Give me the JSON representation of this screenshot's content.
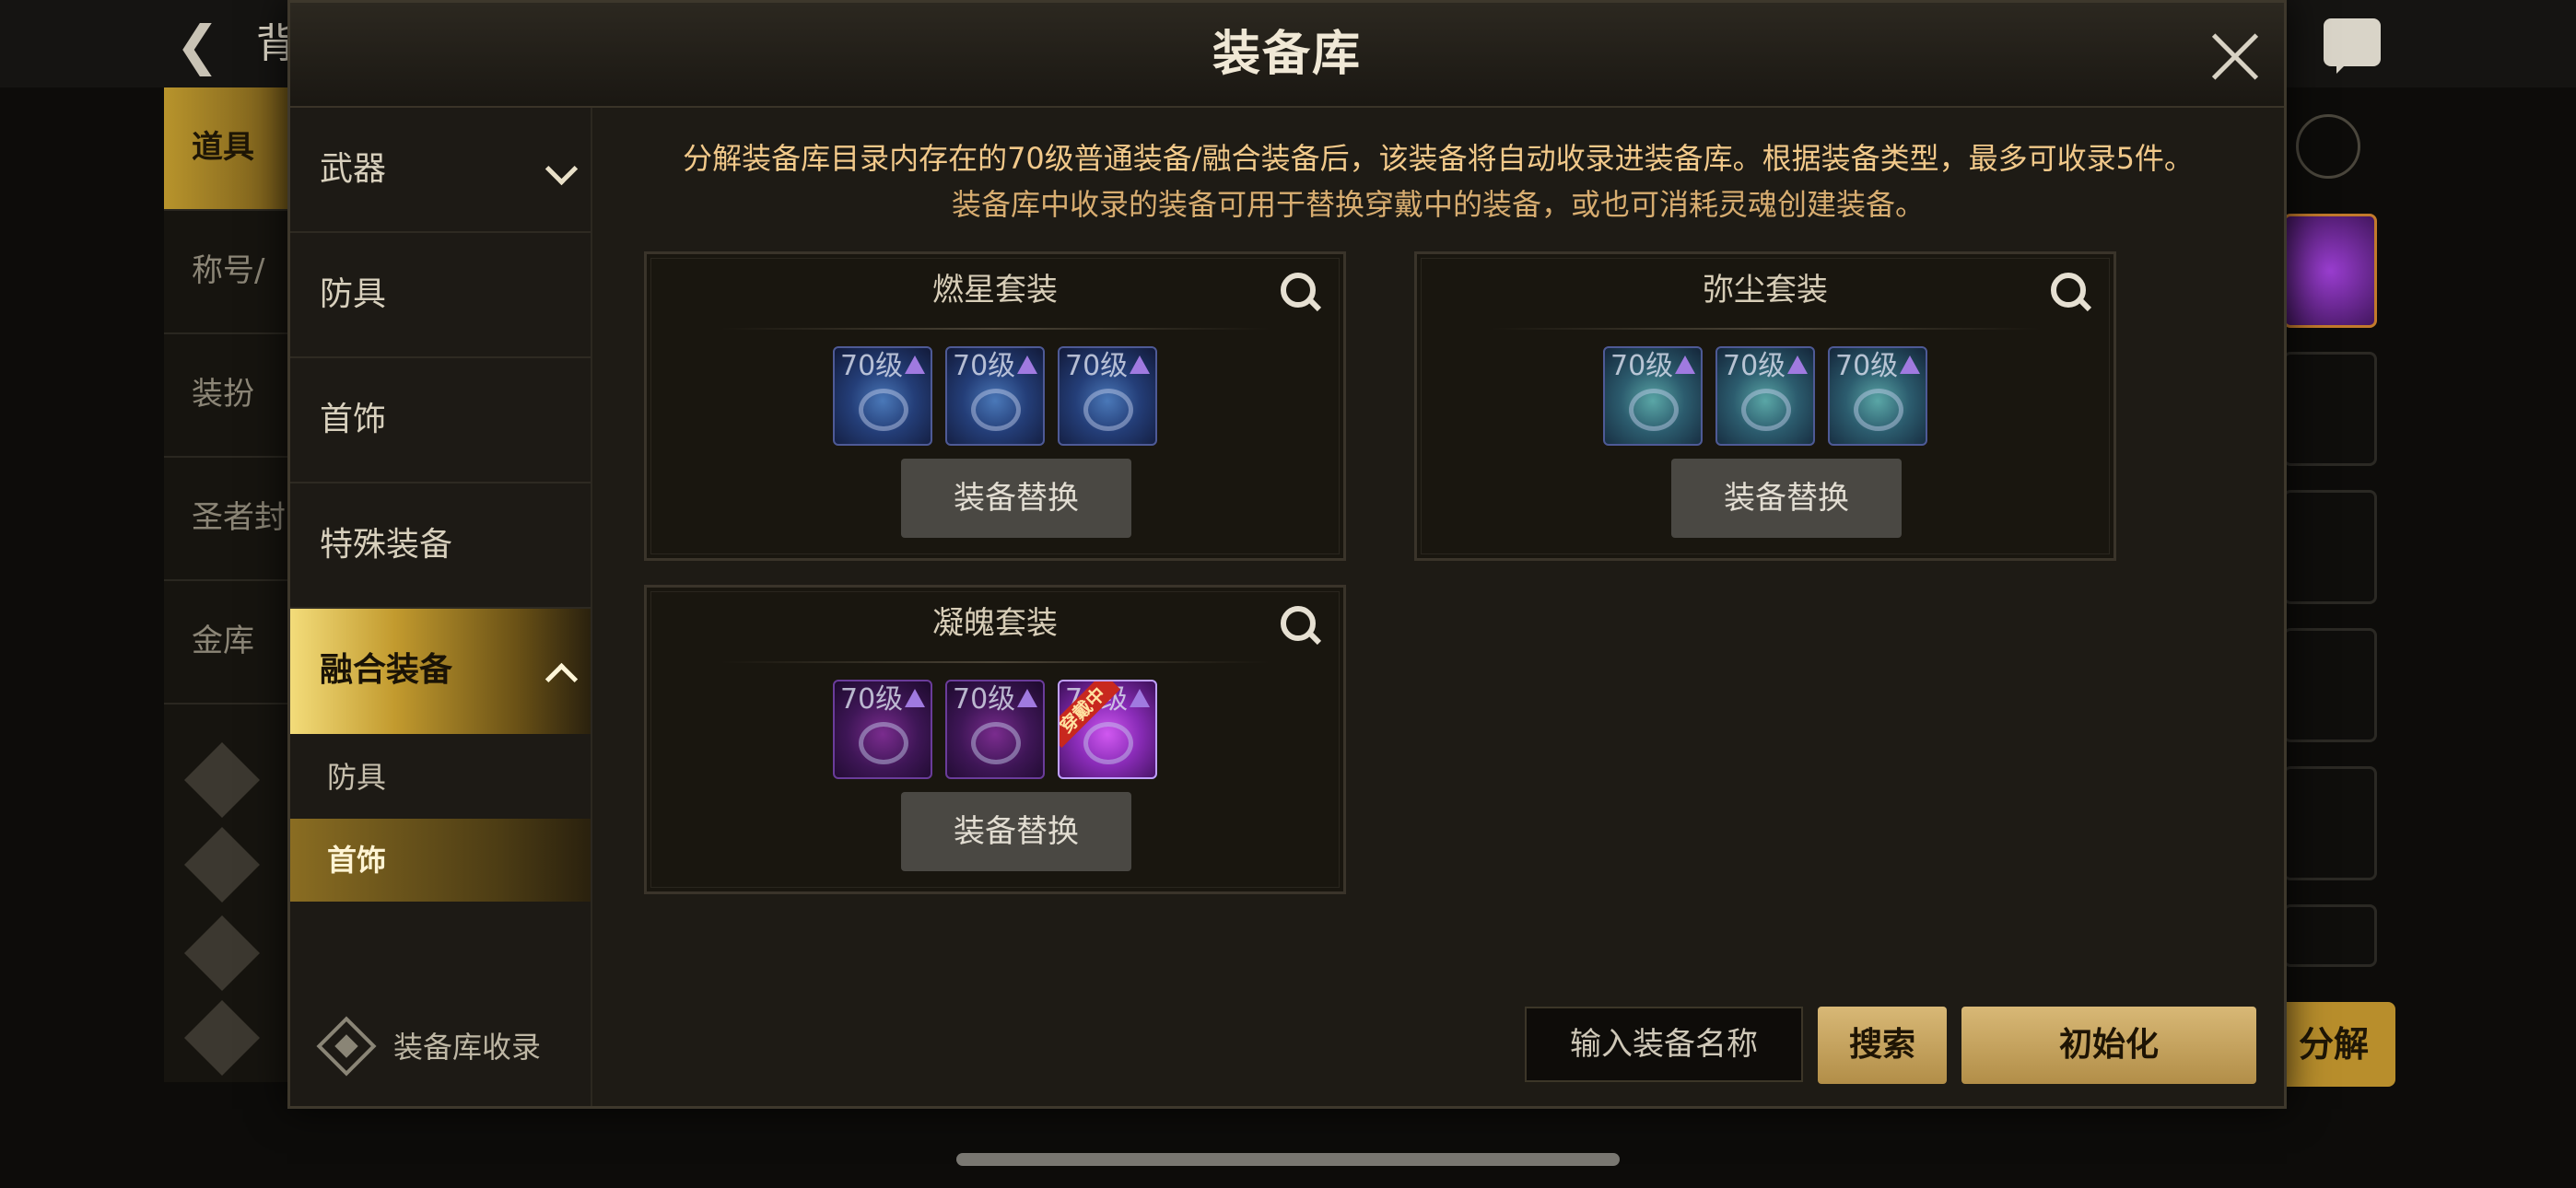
{
  "background": {
    "back_icon": "back-arrow-icon",
    "title": "背",
    "left_tabs": [
      "道具",
      "称号/",
      "装扮",
      "圣者封",
      "金库"
    ],
    "decompose_label": "分解"
  },
  "dialog": {
    "title": "装备库",
    "close_icon": "close-icon",
    "notice_line1": "分解装备库目录内存在的70级普通装备/融合装备后，该装备将自动收录进装备库。根据装备类型，最多可收录5件。",
    "notice_line2": "装备库中收录的装备可用于替换穿戴中的装备，或也可消耗灵魂创建装备。"
  },
  "sidebar": {
    "categories": [
      {
        "label": "武器",
        "expanded": false
      },
      {
        "label": "防具"
      },
      {
        "label": "首饰"
      },
      {
        "label": "特殊装备"
      },
      {
        "label": "融合装备",
        "expanded": true
      }
    ],
    "sub_items": [
      {
        "label": "防具"
      },
      {
        "label": "首饰",
        "selected": true
      }
    ],
    "footer_label": "装备库收录"
  },
  "sets": [
    {
      "name": "燃星套装",
      "slots": [
        {
          "level": "70级",
          "color": "blue"
        },
        {
          "level": "70级",
          "color": "blue"
        },
        {
          "level": "70级",
          "color": "blue"
        }
      ],
      "swap_label": "装备替换"
    },
    {
      "name": "弥尘套装",
      "slots": [
        {
          "level": "70级",
          "color": "teal"
        },
        {
          "level": "70级",
          "color": "teal"
        },
        {
          "level": "70级",
          "color": "teal"
        }
      ],
      "swap_label": "装备替换"
    },
    {
      "name": "凝魄套装",
      "slots": [
        {
          "level": "70级",
          "color": "purple"
        },
        {
          "level": "70级",
          "color": "purple"
        },
        {
          "level": "70级",
          "color": "purple-bright",
          "badge": "穿戴中"
        }
      ],
      "swap_label": "装备替换"
    }
  ],
  "bottom_bar": {
    "search_placeholder": "输入装备名称",
    "search_label": "搜索",
    "init_label": "初始化"
  },
  "colors": {
    "gold_accent": "#c29a2e",
    "notice_text": "#f2c98a",
    "button_gold": "#d8b876"
  }
}
